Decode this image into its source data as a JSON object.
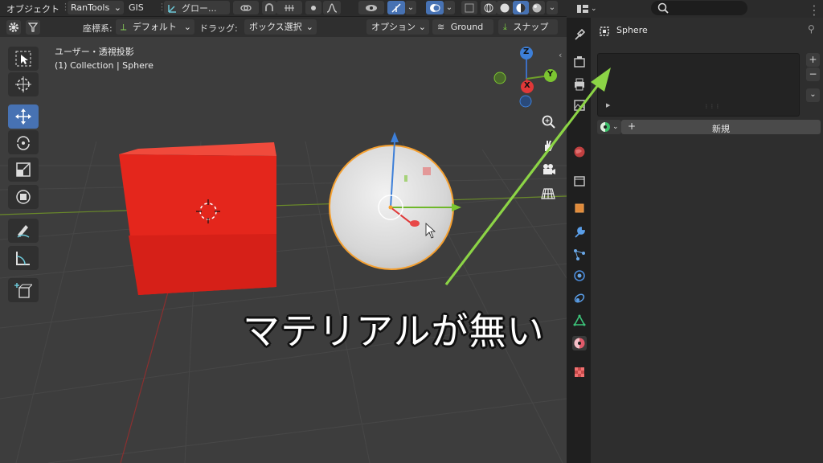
{
  "header": {
    "mode_label": "オブジェクト",
    "addon_rantools": "RanTools",
    "addon_gis": "GIS",
    "transform_orientation": "グロー...",
    "overlay_label": "オプション",
    "ground_label": "Ground",
    "snap_label": "スナップ"
  },
  "toolheader": {
    "coord_label": "座標系:",
    "coord_value": "デフォルト",
    "drag_label": "ドラッグ:",
    "drag_value": "ボックス選択"
  },
  "viewport": {
    "view_name": "ユーザー・透視投影",
    "collection_info": "(1) Collection | Sphere",
    "axes": {
      "z": "Z",
      "y": "Y",
      "x": "X"
    },
    "colors": {
      "cube": "#e4261c",
      "sphere": "#dcdcdc",
      "selection": "#f5a030",
      "annotation_arrow": "#8cd446"
    }
  },
  "annotation": {
    "caption": "マテリアルが無い"
  },
  "properties": {
    "search_placeholder": "",
    "object_name": "Sphere",
    "add_slot": "+",
    "remove_slot": "−",
    "new_material_label": "新規",
    "new_plus": "+"
  }
}
